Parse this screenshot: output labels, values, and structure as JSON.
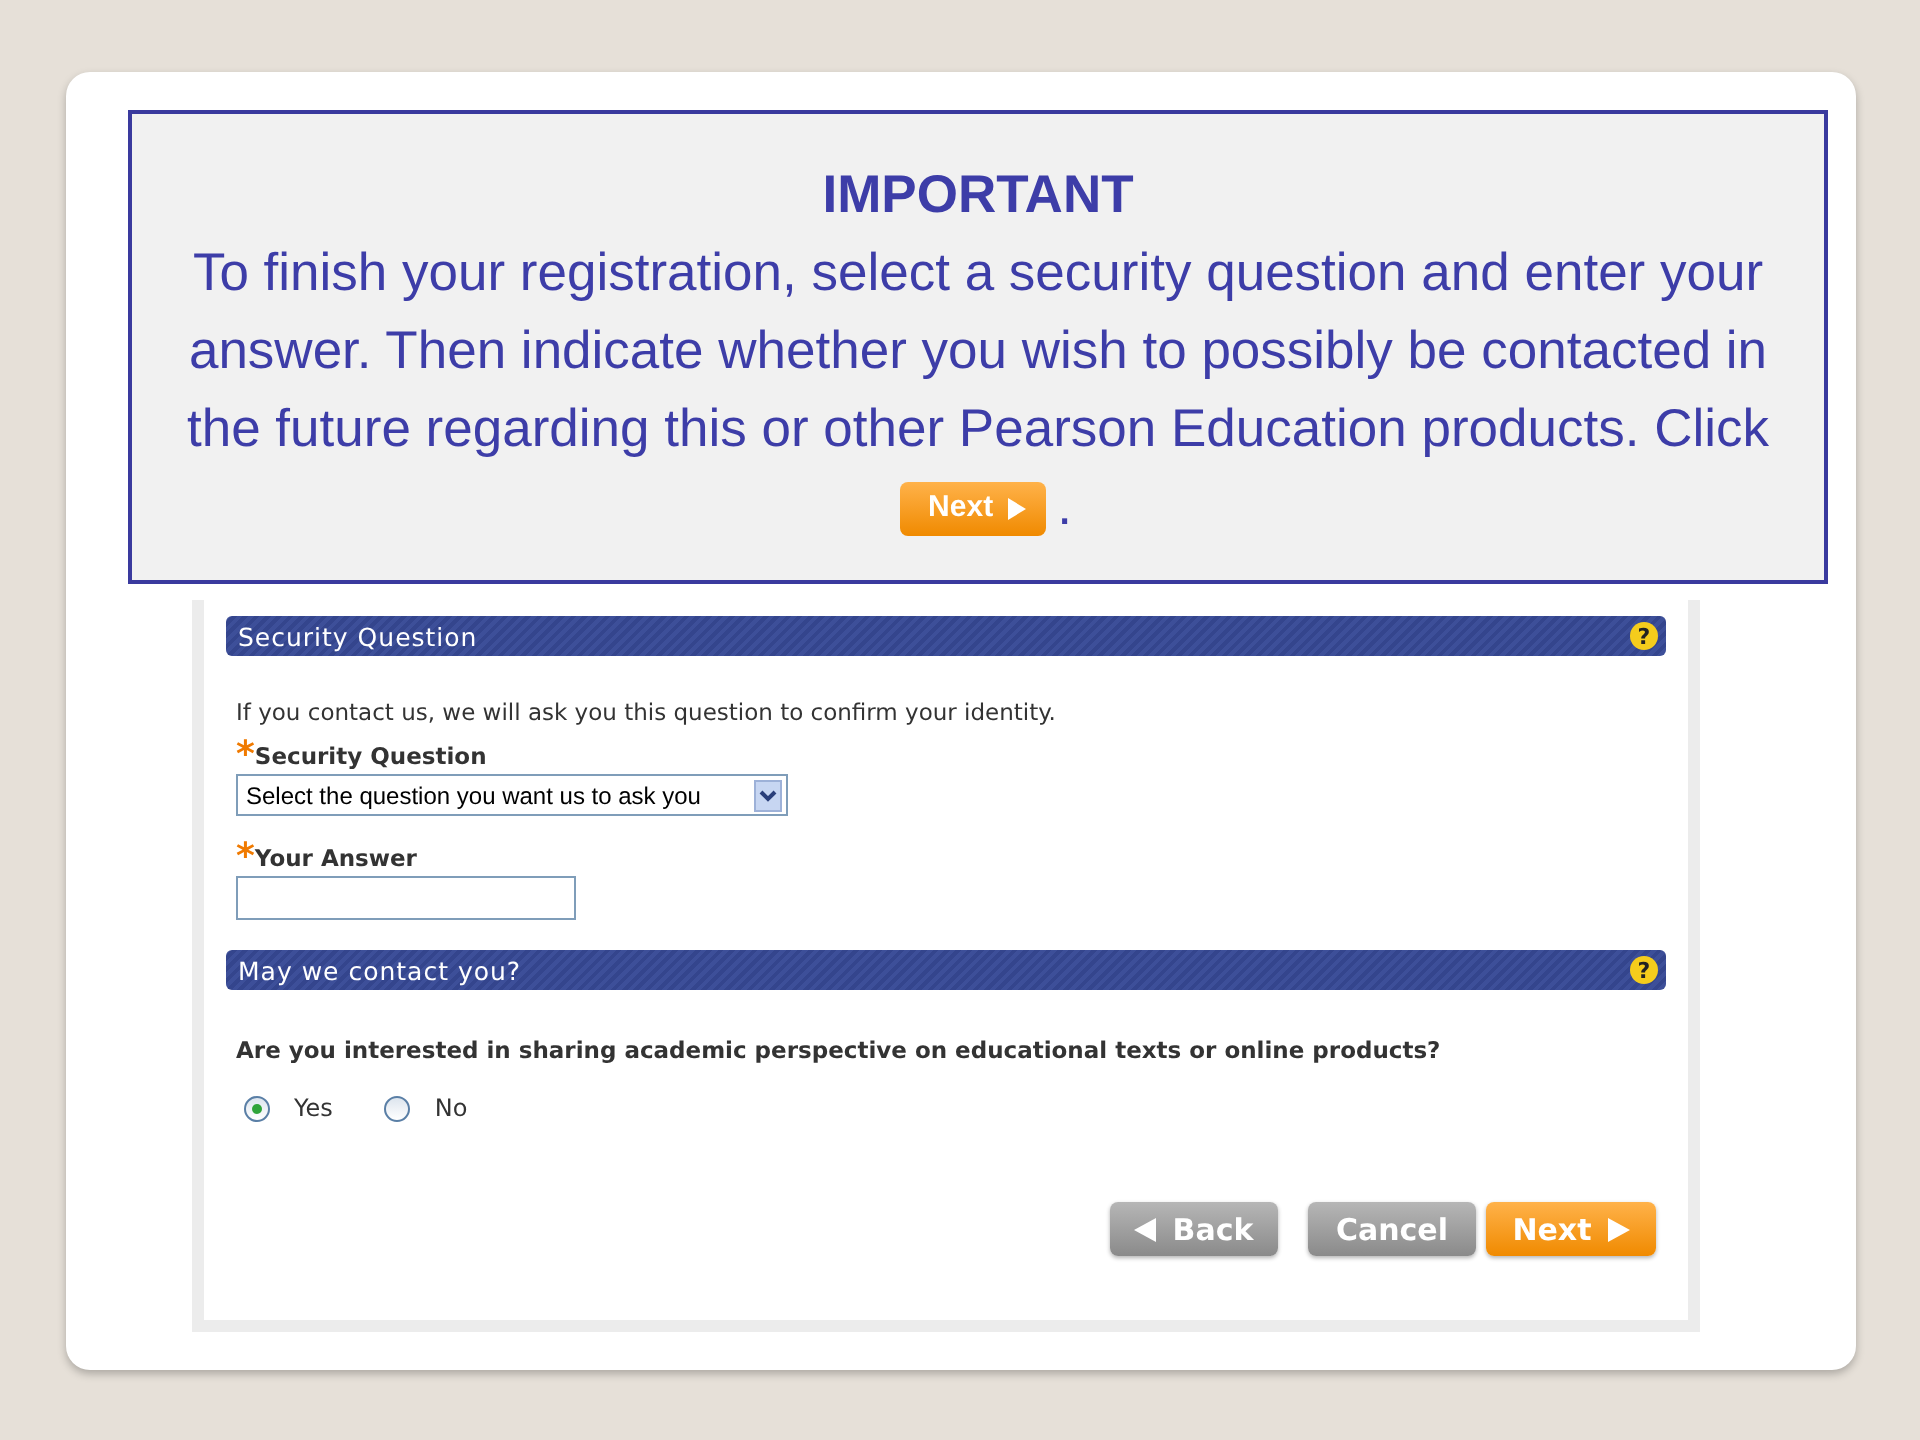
{
  "notice": {
    "heading": "IMPORTANT",
    "text": "To finish your registration, select a security question and enter your answer.  Then indicate whether you wish to possibly be contacted in the future regarding this or other Pearson Education products.  Click",
    "button": "Next",
    "end": "."
  },
  "security": {
    "title": "Security Question",
    "help": "?",
    "intro": "If you contact us, we will ask you this question to confirm your identity.",
    "question": {
      "mark": "*",
      "label": "Security Question",
      "value": "Select the question you want us to ask you"
    },
    "answer": {
      "mark": "*",
      "label": "Your Answer"
    }
  },
  "contact": {
    "title": "May we contact you?",
    "help": "?",
    "question": "Are you interested in sharing academic perspective on educational texts or online products?",
    "options": [
      {
        "label": "Yes",
        "selected": true
      },
      {
        "label": "No",
        "selected": false
      }
    ]
  },
  "buttons": [
    {
      "kind": "back",
      "label": "Back"
    },
    {
      "kind": "cancel",
      "label": "Cancel"
    },
    {
      "kind": "next",
      "label": "Next"
    }
  ]
}
